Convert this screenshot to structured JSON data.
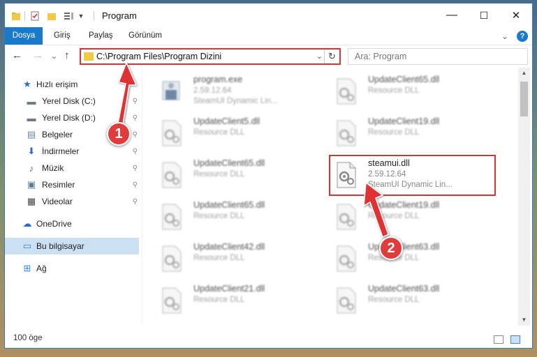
{
  "window": {
    "title": "Program",
    "minimize": "—",
    "maximize": "☐",
    "close": "✕"
  },
  "ribbon": {
    "tabs": [
      "Dosya",
      "Giriş",
      "Paylaş",
      "Görünüm"
    ],
    "expand": "⌄",
    "help": "?"
  },
  "navigation": {
    "back": "←",
    "forward": "→",
    "recent": "⌄",
    "up": "↑",
    "address": "C:\\Program Files\\Program Dizini",
    "address_dropdown": "⌄",
    "refresh": "↻",
    "search_placeholder": "Ara: Program"
  },
  "sidebar": {
    "items": [
      {
        "label": "Hızlı erişim",
        "icon": "star-icon",
        "glyph": "★",
        "color": "#2a6fc9"
      },
      {
        "label": "Yerel Disk (C:)",
        "icon": "drive-icon",
        "glyph": "▬",
        "color": "#6a7a88",
        "pinned": true
      },
      {
        "label": "Yerel Disk (D:)",
        "icon": "drive-icon",
        "glyph": "▬",
        "color": "#6a7a88",
        "pinned": true
      },
      {
        "label": "Belgeler",
        "icon": "documents-icon",
        "glyph": "▤",
        "color": "#6a86a8",
        "pinned": true
      },
      {
        "label": "İndirmeler",
        "icon": "download-icon",
        "glyph": "⬇",
        "color": "#2a6fc9",
        "pinned": true
      },
      {
        "label": "Müzik",
        "icon": "music-icon",
        "glyph": "♪",
        "color": "#2a6fc9",
        "pinned": true
      },
      {
        "label": "Resimler",
        "icon": "pictures-icon",
        "glyph": "▣",
        "color": "#5a7a98",
        "pinned": true
      },
      {
        "label": "Videolar",
        "icon": "videos-icon",
        "glyph": "▦",
        "color": "#444",
        "pinned": true
      },
      {
        "label": "OneDrive",
        "icon": "cloud-icon",
        "glyph": "☁",
        "color": "#1f6fd1"
      },
      {
        "label": "Bu bilgisayar",
        "icon": "computer-icon",
        "glyph": "▭",
        "color": "#2a8ad8",
        "selected": true
      },
      {
        "label": "Ağ",
        "icon": "network-icon",
        "glyph": "⊞",
        "color": "#2a8ad8"
      }
    ],
    "pin_glyph": "📌"
  },
  "files": [
    {
      "name": "program.exe",
      "line1": "2.59.12.64",
      "line2": "SteamUI Dynamic Lin...",
      "kind": "exe",
      "blurred": true
    },
    {
      "name": "UpdateClient65.dll",
      "line1": "Resource DLL",
      "line2": "",
      "kind": "dll",
      "blurred": true
    },
    {
      "name": "UpdateClient5.dll",
      "line1": "Resource DLL",
      "line2": "",
      "kind": "dll",
      "blurred": true
    },
    {
      "name": "UpdateClient19.dll",
      "line1": "Resource DLL",
      "line2": "",
      "kind": "dll",
      "blurred": true
    },
    {
      "name": "UpdateClient65.dll",
      "line1": "Resource DLL",
      "line2": "",
      "kind": "dll",
      "blurred": true
    },
    {
      "name": "steamui.dll",
      "line1": "2.59.12.64",
      "line2": "SteamUI Dynamic Lin...",
      "kind": "dll",
      "blurred": false
    },
    {
      "name": "UpdateClient65.dll",
      "line1": "Resource DLL",
      "line2": "",
      "kind": "dll",
      "blurred": true
    },
    {
      "name": "UpdateClient19.dll",
      "line1": "Resource DLL",
      "line2": "",
      "kind": "dll",
      "blurred": true
    },
    {
      "name": "UpdateClient42.dll",
      "line1": "Resource DLL",
      "line2": "",
      "kind": "dll",
      "blurred": true
    },
    {
      "name": "UpdateClient63.dll",
      "line1": "Resource DLL",
      "line2": "",
      "kind": "dll",
      "blurred": true
    },
    {
      "name": "UpdateClient21.dll",
      "line1": "Resource DLL",
      "line2": "",
      "kind": "dll",
      "blurred": true
    },
    {
      "name": "UpdateClient63.dll",
      "line1": "Resource DLL",
      "line2": "",
      "kind": "dll",
      "blurred": true
    }
  ],
  "status": {
    "item_count": "100 öge"
  },
  "annotations": {
    "step1": "1",
    "step2": "2",
    "color": "#e03030"
  }
}
